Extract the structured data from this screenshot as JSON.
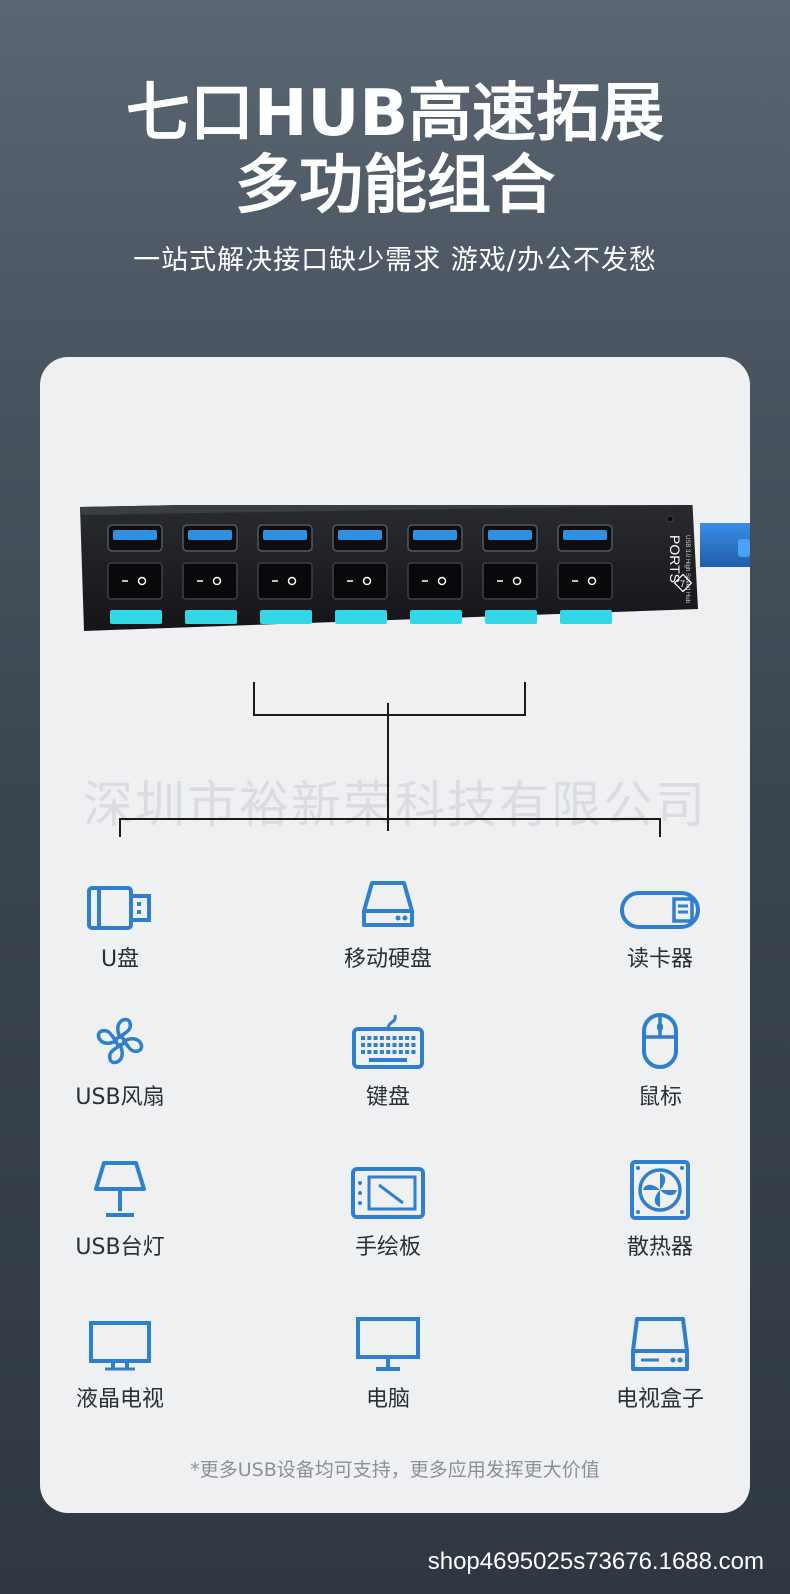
{
  "header": {
    "title_line1": "七口HUB高速拓展",
    "title_line2": "多功能组合",
    "subtitle": "一站式解决接口缺少需求 游戏/办公不发愁"
  },
  "product": {
    "label_ports": "PORTS",
    "label_small": "USB 3.0 High Speed Hub",
    "port_count_badge": "7",
    "port_count": 7
  },
  "watermark": "深圳市裕新荣科技有限公司",
  "devices": [
    {
      "label": "U盘",
      "icon": "usb-drive-icon"
    },
    {
      "label": "移动硬盘",
      "icon": "external-hdd-icon"
    },
    {
      "label": "读卡器",
      "icon": "card-reader-icon"
    },
    {
      "label": "USB风扇",
      "icon": "fan-icon"
    },
    {
      "label": "键盘",
      "icon": "keyboard-icon"
    },
    {
      "label": "鼠标",
      "icon": "mouse-icon"
    },
    {
      "label": "USB台灯",
      "icon": "desk-lamp-icon"
    },
    {
      "label": "手绘板",
      "icon": "drawing-tablet-icon"
    },
    {
      "label": "散热器",
      "icon": "cooler-icon"
    },
    {
      "label": "液晶电视",
      "icon": "lcd-tv-icon"
    },
    {
      "label": "电脑",
      "icon": "computer-monitor-icon"
    },
    {
      "label": "电视盒子",
      "icon": "tv-box-icon"
    }
  ],
  "note": "*更多USB设备均可支持，更多应用发挥更大价值",
  "footer": "shop4695025s73676.1688.com",
  "colors": {
    "icon_blue": "#2f7fd0",
    "led_cyan": "#33d8e6",
    "usb_blue": "#2f8fe0"
  }
}
